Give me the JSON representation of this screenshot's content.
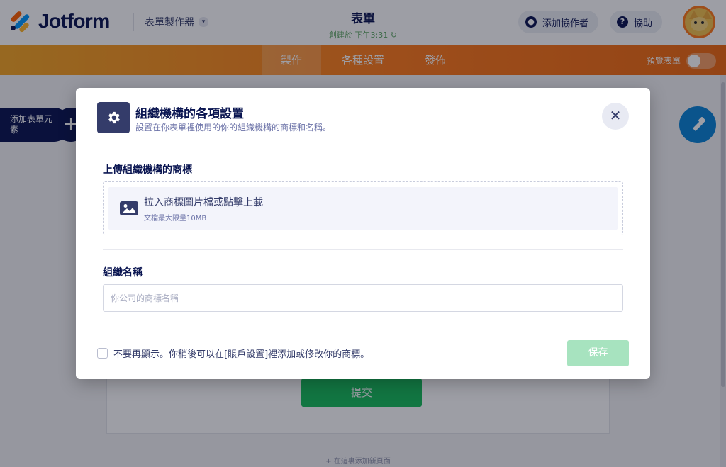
{
  "header": {
    "logo_text": "Jotform",
    "builder_label": "表單製作器",
    "form_title": "表單",
    "saved_status": "創建於 下午3:31",
    "add_collaborator": "添加協作者",
    "help": "協助"
  },
  "navbar": {
    "tabs": [
      {
        "label": "製作"
      },
      {
        "label": "各種設置"
      },
      {
        "label": "發佈"
      }
    ],
    "preview_label": "預覽表單"
  },
  "canvas": {
    "add_element_label": "添加表單元素",
    "submit_label": "提交",
    "add_page_label": "+ 在這裏添加新頁面"
  },
  "modal": {
    "title": "組織機構的各項設置",
    "subtitle": "設置在你表單裡使用的你的組織機構的商標和名稱。",
    "upload_section_label": "上傳組織機構的商標",
    "upload_main": "拉入商標圖片檔或點擊上載",
    "upload_hint": "文檔最大限量10MB",
    "name_section_label": "組織名稱",
    "name_placeholder": "你公司的商標名稱",
    "name_value": "",
    "dont_show_label": "不要再顯示。你稍後可以在[賬戶設置]裡添加或修改你的商標。",
    "save_label": "保存"
  },
  "colors": {
    "brand_navy": "#0a1551",
    "nav_orange": "#ff7a1a",
    "submit_green": "#18bd5b",
    "save_disabled": "#a7e3bf",
    "paint_blue": "#0a84d6"
  }
}
